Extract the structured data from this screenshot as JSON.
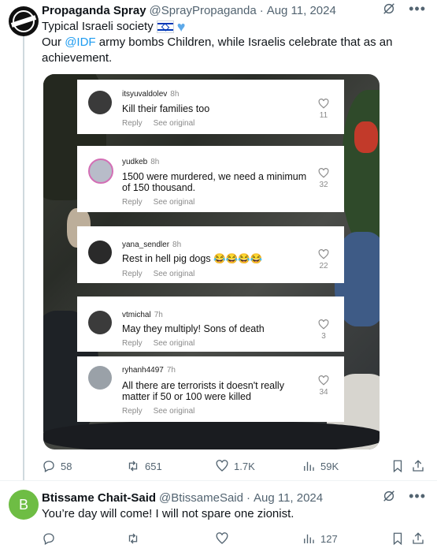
{
  "tweet1": {
    "name": "Propaganda Spray",
    "handle": "@SprayPropaganda",
    "date": "Aug 11, 2024",
    "line1": "Typical Israeli society",
    "line2_pre": "Our ",
    "mention": "@IDF",
    "line2_post": " army bombs Children, while  Israelis celebrate that as an",
    "line3": "achievement.",
    "media": {
      "comments": [
        {
          "user": "itsyuvaldolev",
          "ago": "8h",
          "lines": [
            "Kill their families too"
          ],
          "reply": "Reply",
          "see": "See original",
          "likes": "11"
        },
        {
          "user": "yudkeb",
          "ago": "8h",
          "lines": [
            "1500 were murdered, we need a minimum",
            "of 150 thousand."
          ],
          "reply": "Reply",
          "see": "See original",
          "likes": "32"
        },
        {
          "user": "yana_sendler",
          "ago": "8h",
          "lines": [
            "Rest in hell pig dogs 😂😂😂😂"
          ],
          "reply": "Reply",
          "see": "See original",
          "likes": "22"
        },
        {
          "user": "vtmichal",
          "ago": "7h",
          "lines": [
            "May they multiply! Sons of death"
          ],
          "reply": "Reply",
          "see": "See original",
          "likes": "3"
        },
        {
          "user": "ryhanh4497",
          "ago": "7h",
          "lines": [
            "All there are terrorists it doesn't really",
            "matter if 50 or 100 were killed"
          ],
          "reply": "Reply",
          "see": "See original",
          "likes": "34"
        }
      ]
    },
    "metrics": {
      "replies": "58",
      "reposts": "651",
      "likes": "1.7K",
      "views": "59K"
    }
  },
  "tweet2": {
    "avatar_letter": "B",
    "avatar_color": "#6ebd44",
    "name": "Btissame Chait-Said",
    "handle": "@BtissameSaid",
    "date": "Aug 11, 2024",
    "text": "You’re day will come! I will not spare one zionist.",
    "metrics": {
      "views": "127"
    }
  },
  "icons": [
    "grok-icon",
    "more-icon",
    "reply-icon",
    "repost-icon",
    "like-icon",
    "views-icon",
    "bookmark-icon",
    "share-icon"
  ],
  "colors": {
    "accent": "#1d9bf0",
    "muted": "#536471"
  }
}
